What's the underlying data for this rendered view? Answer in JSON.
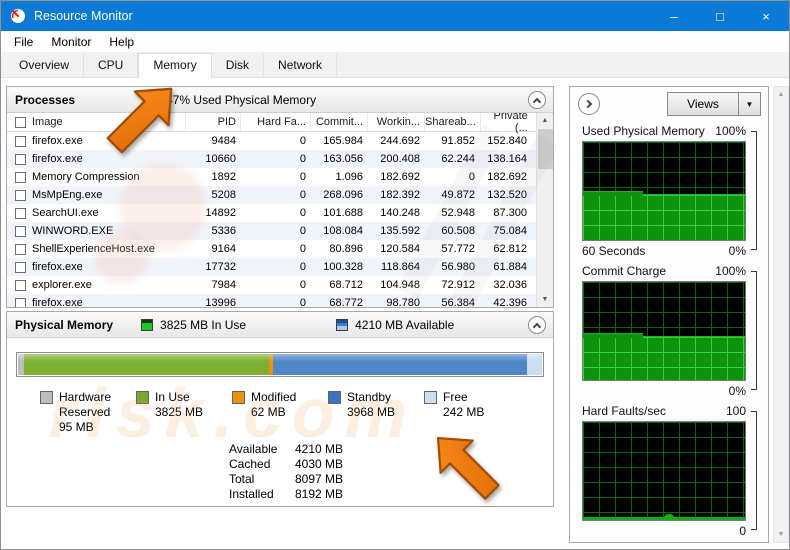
{
  "window": {
    "title": "Resource Monitor"
  },
  "titlebar": {
    "controls": {
      "minimize": "–",
      "maximize": "□",
      "close": "×"
    }
  },
  "menu": {
    "items": [
      "File",
      "Monitor",
      "Help"
    ]
  },
  "tabs": {
    "items": [
      "Overview",
      "CPU",
      "Memory",
      "Disk",
      "Network"
    ],
    "active_index": 2
  },
  "processes": {
    "title": "Processes",
    "status_label": "47% Used Physical Memory",
    "columns": [
      "Image",
      "PID",
      "Hard Fa...",
      "Commit...",
      "Workin...",
      "Shareab...",
      "Private (..."
    ],
    "rows": [
      [
        "firefox.exe",
        "9484",
        "0",
        "165.984",
        "244.692",
        "91.852",
        "152.840"
      ],
      [
        "firefox.exe",
        "10660",
        "0",
        "163.056",
        "200.408",
        "62.244",
        "138.164"
      ],
      [
        "Memory Compression",
        "1892",
        "0",
        "1.096",
        "182.692",
        "0",
        "182.692"
      ],
      [
        "MsMpEng.exe",
        "5208",
        "0",
        "268.096",
        "182.392",
        "49.872",
        "132.520"
      ],
      [
        "SearchUI.exe",
        "14892",
        "0",
        "101.688",
        "140.248",
        "52.948",
        "87.300"
      ],
      [
        "WINWORD.EXE",
        "5336",
        "0",
        "108.084",
        "135.592",
        "60.508",
        "75.084"
      ],
      [
        "ShellExperienceHost.exe",
        "9164",
        "0",
        "80.896",
        "120.584",
        "57.772",
        "62.812"
      ],
      [
        "firefox.exe",
        "17732",
        "0",
        "100.328",
        "118.864",
        "56.980",
        "61.884"
      ],
      [
        "explorer.exe",
        "7984",
        "0",
        "68.712",
        "104.948",
        "72.912",
        "32.036"
      ],
      [
        "firefox.exe",
        "13996",
        "0",
        "68.772",
        "98.780",
        "56.384",
        "42.396"
      ]
    ]
  },
  "physical_memory": {
    "title": "Physical Memory",
    "in_use_label": "3825 MB In Use",
    "available_label": "4210 MB Available",
    "segments": [
      {
        "name": "Hardware Reserved",
        "pct": 1.2,
        "color": "#bdbdbd"
      },
      {
        "name": "In Use",
        "pct": 46.7,
        "color": "#7cb032"
      },
      {
        "name": "Modified",
        "pct": 0.8,
        "color": "#e8920e"
      },
      {
        "name": "Standby",
        "pct": 48.4,
        "color": "#4e86c8"
      },
      {
        "name": "Free",
        "pct": 2.9,
        "color": "#cadef2"
      }
    ],
    "legend": [
      {
        "lines": [
          "Hardware",
          "Reserved",
          "95 MB"
        ],
        "color": "#bdbdbd"
      },
      {
        "lines": [
          "In Use",
          "3825 MB"
        ],
        "color": "#76a830"
      },
      {
        "lines": [
          "Modified",
          "62 MB"
        ],
        "color": "#e8920e"
      },
      {
        "lines": [
          "Standby",
          "3968 MB"
        ],
        "color": "#3d74c0"
      },
      {
        "lines": [
          "Free",
          "242 MB"
        ],
        "color": "#cadef2"
      }
    ],
    "stats": [
      {
        "label": "Available",
        "value": "4210 MB"
      },
      {
        "label": "Cached",
        "value": "4030 MB"
      },
      {
        "label": "Total",
        "value": "8097 MB"
      },
      {
        "label": "Installed",
        "value": "8192 MB"
      }
    ]
  },
  "sidebar": {
    "views_label": "Views",
    "graphs": [
      {
        "title": "Used Physical Memory",
        "max_label": "100%",
        "min_label": "0%",
        "x_label": "60 Seconds",
        "fill_pct": 47
      },
      {
        "title": "Commit Charge",
        "max_label": "100%",
        "min_label": "0%",
        "x_label": "",
        "fill_pct": 45
      },
      {
        "title": "Hard Faults/sec",
        "max_label": "100",
        "min_label": "0",
        "x_label": "",
        "fill_pct": 0
      }
    ]
  },
  "colors": {
    "titlebar": "#0b79d6",
    "graph_fill": "#0d930d",
    "graph_grid": "#0b650b",
    "arrow": "#ee7911"
  }
}
